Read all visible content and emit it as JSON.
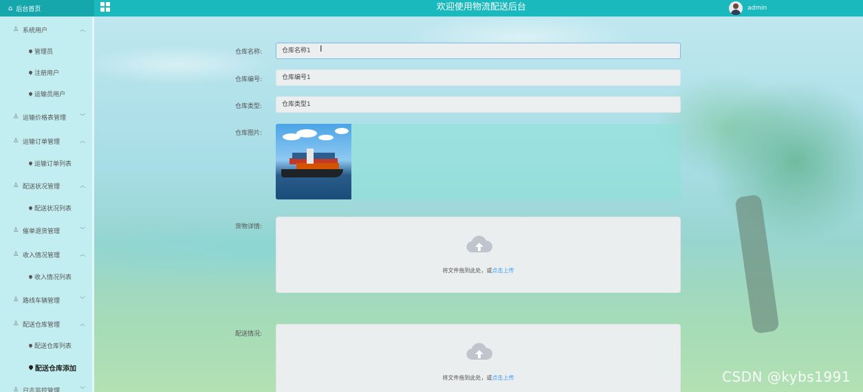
{
  "header": {
    "brand": "后台首页",
    "title": "欢迎使用物流配送后台",
    "username": "admin"
  },
  "sidebar": {
    "groups": [
      {
        "label": "系统用户",
        "expanded": true,
        "items": [
          "管理员",
          "注册用户",
          "运输员用户"
        ]
      },
      {
        "label": "运输价格表管理",
        "expanded": false,
        "items": []
      },
      {
        "label": "运输订单管理",
        "expanded": true,
        "items": [
          "运输订单列表"
        ]
      },
      {
        "label": "配送状况管理",
        "expanded": true,
        "items": [
          "配送状况列表"
        ]
      },
      {
        "label": "催单退货管理",
        "expanded": false,
        "items": []
      },
      {
        "label": "收入情况管理",
        "expanded": true,
        "items": [
          "收入情况列表"
        ]
      },
      {
        "label": "路线车辆管理",
        "expanded": false,
        "items": []
      },
      {
        "label": "配送仓库管理",
        "expanded": true,
        "items": [
          "配送仓库列表",
          "配送仓库添加"
        ]
      },
      {
        "label": "日志监控管理",
        "expanded": false,
        "items": []
      }
    ],
    "active_item": "配送仓库添加"
  },
  "form": {
    "name_label": "仓库名称:",
    "name_value": "仓库名称1",
    "code_label": "仓库编号:",
    "code_value": "仓库编号1",
    "type_label": "仓库类型:",
    "type_value": "仓库类型1",
    "image_label": "仓库图片:",
    "goods_label": "货物详情:",
    "delivery_label": "配送情况:",
    "upload_text": "将文件拖到此处，或",
    "upload_link": "点击上传"
  },
  "watermark": "CSDN @kybs1991",
  "colors": {
    "topbar": "#1ab9be",
    "sidebar": "#c3eef1",
    "link": "#409eff"
  }
}
